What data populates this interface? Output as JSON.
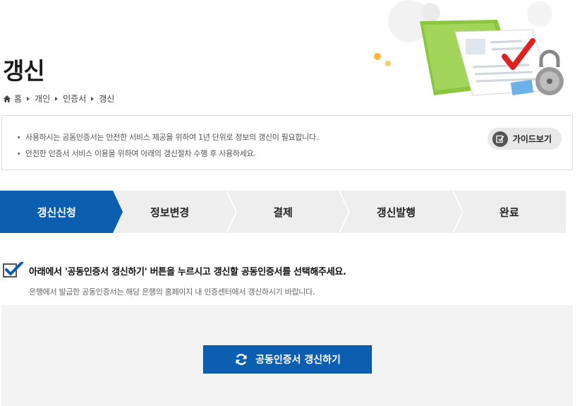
{
  "page": {
    "title": "갱신"
  },
  "breadcrumb": {
    "home_icon": "home-icon",
    "items": [
      "홈",
      "개인",
      "인증서",
      "갱신"
    ]
  },
  "notice": {
    "items": [
      "사용하시는 공동인증서는 안전한 서비스 제공을 위하여 1년 단위로 정보의 갱신이 필요합니다.",
      "안전한 인증서 서비스 이용을 위하여 아래의 갱신절차 수행 후 사용하세요."
    ],
    "guide_label": "가이드보기",
    "guide_icon": "guide-icon"
  },
  "steps": {
    "items": [
      "갱신신청",
      "정보변경",
      "결제",
      "갱신발행",
      "완료"
    ],
    "active_index": 0
  },
  "instruction": {
    "title": "아래에서 '공동인증서 갱신하기' 버튼을 누르시고 갱신할 공동인증서를 선택해주세요.",
    "subtitle": "은행에서 발급한 공동인증서는 해당 은행의 홈페이지 내 인증센터에서 갱신하시기 바랍니다."
  },
  "action": {
    "renew_label": "공동인증서 갱신하기",
    "renew_icon": "refresh-icon"
  },
  "colors": {
    "primary": "#0b5eb0",
    "step_bg": "#eeeeee",
    "area_bg": "#f3f3f3"
  }
}
